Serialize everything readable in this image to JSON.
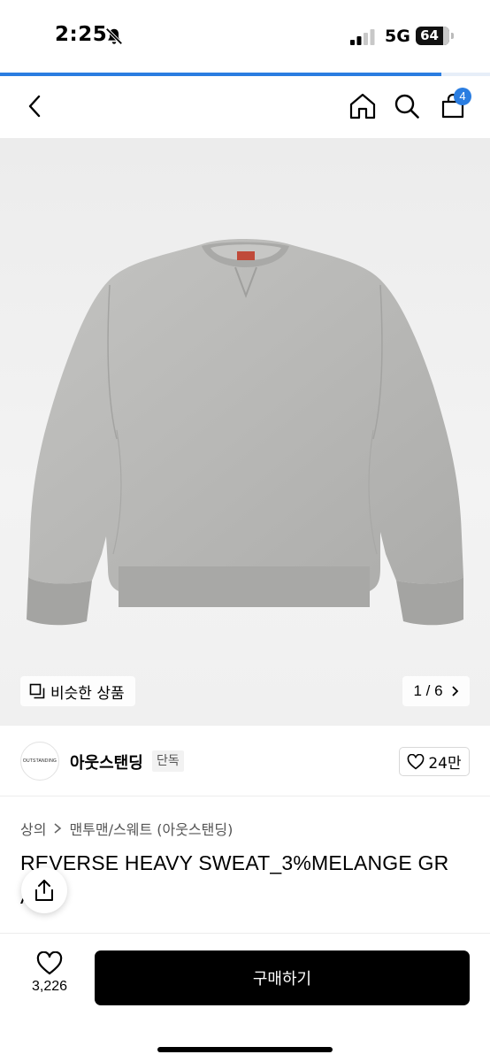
{
  "status_bar": {
    "time": "2:25",
    "network": "5G",
    "battery": "64"
  },
  "loading": {
    "progress": 0.9
  },
  "nav": {
    "back_icon": "chevron-left-icon",
    "home_icon": "home-icon",
    "search_icon": "search-icon",
    "cart_icon": "cart-icon",
    "cart_count": "4"
  },
  "gallery": {
    "similar_label": "비슷한 상품",
    "page_indicator": "1 / 6"
  },
  "brand": {
    "logo_text": "OUTSTANDING",
    "name": "아웃스탠딩",
    "tag": "단독",
    "likes": "24만"
  },
  "breadcrumb": {
    "level1": "상의",
    "level2": "맨투맨/스웨트 (아웃스탠딩)"
  },
  "product": {
    "title_line1": "REVERSE HEAVY SWEAT_3%MELANGE GR",
    "title_line2": "A"
  },
  "bottom_bar": {
    "wish_count": "3,226",
    "buy_label": "구매하기"
  },
  "colors": {
    "accent": "#2a7de1",
    "buy_button": "#000000",
    "sweatshirt": "#b9b9b7"
  }
}
